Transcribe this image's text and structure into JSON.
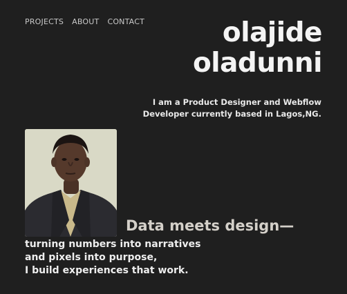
{
  "nav": {
    "items": [
      {
        "label": "PROJECTS"
      },
      {
        "label": "ABOUT"
      },
      {
        "label": "CONTACT"
      }
    ]
  },
  "hero": {
    "name_line1": "olajide",
    "name_line2": "oladunni",
    "intro_line1": "I am a Product Designer and Webflow",
    "intro_line2": "Developer currently based in Lagos,NG."
  },
  "profile": {
    "photo_alt": "Portrait of Olajide Oladunni"
  },
  "statement": {
    "headline": "Data meets design—",
    "line1": "turning numbers into narratives",
    "line2": "and pixels into purpose,",
    "line3": "I build experiences that work."
  },
  "colors": {
    "background": "#1f1f1f",
    "text": "#f2f2f2",
    "headline": "#d4d0c9",
    "photo_background": "#dcdcc9"
  }
}
